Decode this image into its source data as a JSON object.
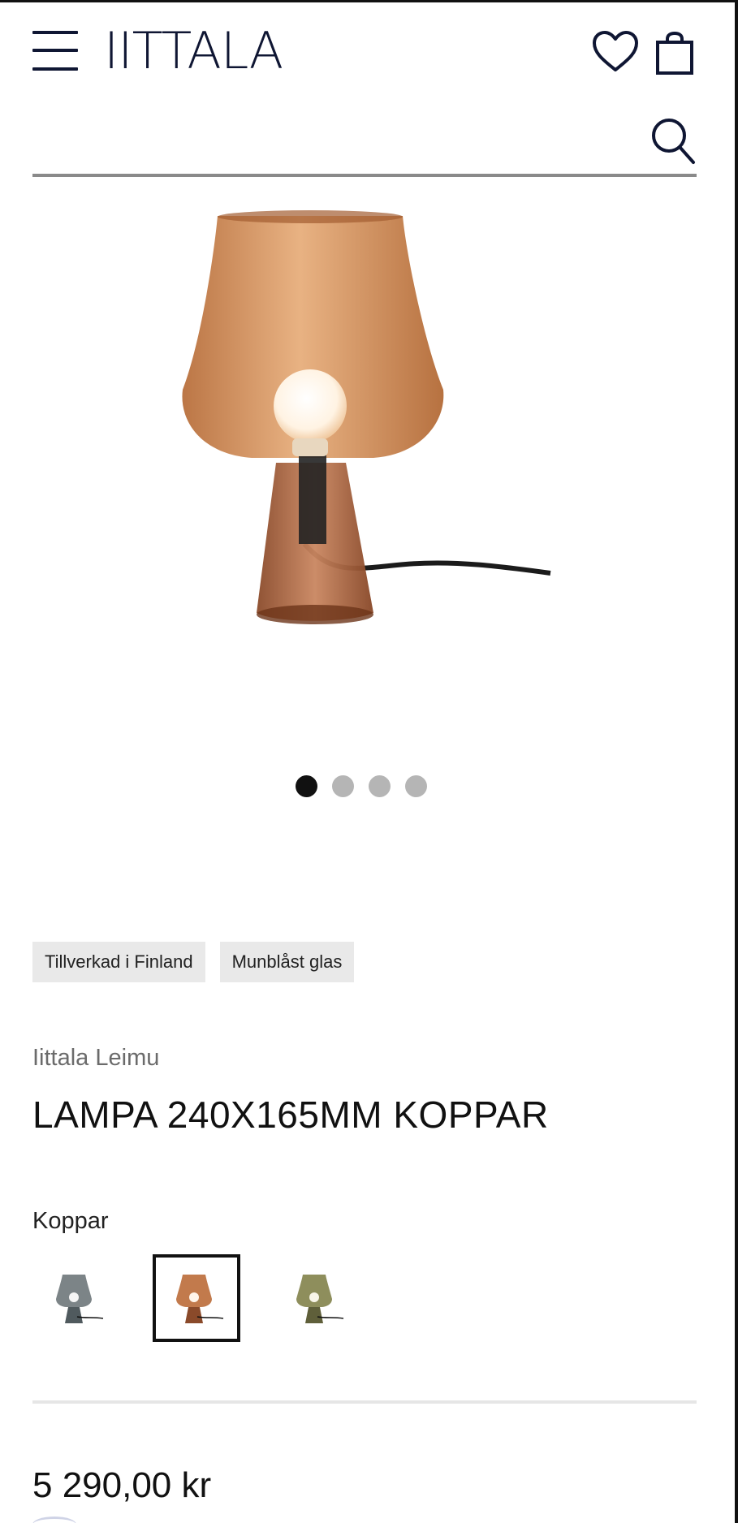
{
  "header": {
    "logo_text": "IITTALA",
    "menu_icon": "hamburger-icon",
    "wishlist_icon": "heart-icon",
    "bag_icon": "shopping-bag-icon",
    "brand_color": "#0f1633"
  },
  "search": {
    "value": "",
    "placeholder": "",
    "icon": "search-icon"
  },
  "gallery": {
    "image_alt": "Copper glass table lamp",
    "slide_count": 4,
    "active_slide": 1,
    "product_color": "#c98a5a"
  },
  "tags": [
    "Tillverkad i Finland",
    "Munblåst glas"
  ],
  "product": {
    "brand": "Iittala Leimu",
    "title": "LAMPA 240X165MM KOPPAR",
    "color_label": "Koppar",
    "swatches": [
      {
        "name": "Grå",
        "color": "#7c8487",
        "selected": false
      },
      {
        "name": "Koppar",
        "color": "#c27a4c",
        "selected": true
      },
      {
        "name": "Mossgrön",
        "color": "#8e8e5c",
        "selected": false
      }
    ],
    "price": "5 290,00 kr"
  }
}
